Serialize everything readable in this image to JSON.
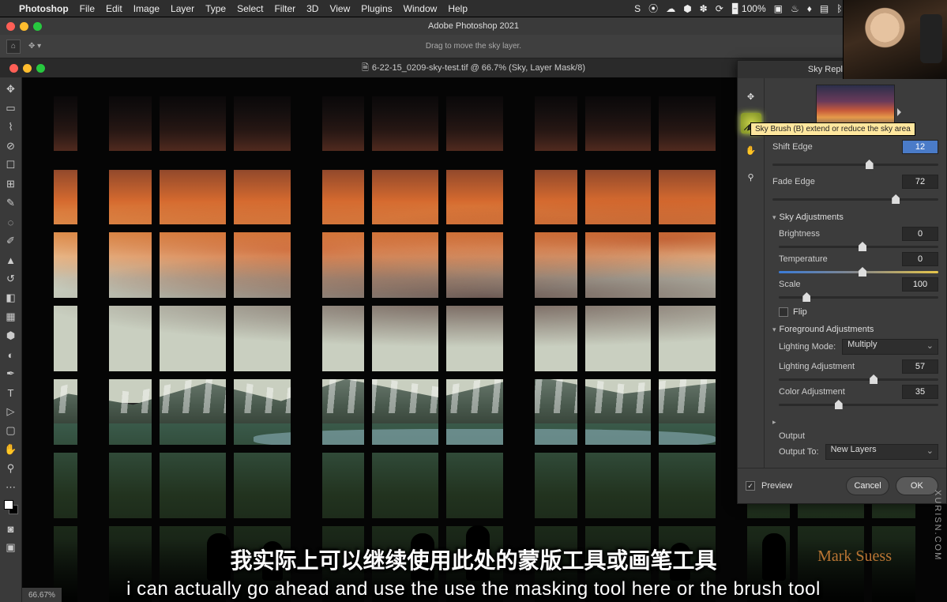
{
  "menubar": {
    "app": "Photoshop",
    "items": [
      "File",
      "Edit",
      "Image",
      "Layer",
      "Type",
      "Select",
      "Filter",
      "3D",
      "View",
      "Plugins",
      "Window",
      "Help"
    ],
    "right_status": "100%"
  },
  "window": {
    "title": "Adobe Photoshop 2021"
  },
  "options_bar": {
    "hint": "Drag to move the sky layer."
  },
  "document_tab": {
    "label": "6-22-15_0209-sky-test.tif @ 66.7% (Sky, Layer Mask/8)"
  },
  "status": {
    "zoom": "66.67%"
  },
  "panel": {
    "title": "Sky Replacement",
    "tooltip": "Sky Brush (B) extend or reduce the sky area",
    "shift_edge": {
      "label": "Shift Edge",
      "value": "12",
      "pos": 56
    },
    "fade_edge": {
      "label": "Fade Edge",
      "value": "72",
      "pos": 72
    },
    "section_sky": "Sky Adjustments",
    "brightness": {
      "label": "Brightness",
      "value": "0",
      "pos": 50
    },
    "temperature": {
      "label": "Temperature",
      "value": "0",
      "pos": 50
    },
    "scale": {
      "label": "Scale",
      "value": "100",
      "pos": 15
    },
    "flip_label": "Flip",
    "flip_checked": false,
    "section_fg": "Foreground Adjustments",
    "lighting_mode_label": "Lighting Mode:",
    "lighting_mode_value": "Multiply",
    "lighting_adj": {
      "label": "Lighting Adjustment",
      "value": "57",
      "pos": 57
    },
    "color_adj": {
      "label": "Color Adjustment",
      "value": "35",
      "pos": 35
    },
    "section_output": "Output",
    "output_to_label": "Output To:",
    "output_to_value": "New Layers",
    "preview_label": "Preview",
    "preview_checked": true,
    "cancel": "Cancel",
    "ok": "OK"
  },
  "subtitles": {
    "cn": "我实际上可以继续使用此处的蒙版工具或画笔工具",
    "en": "i can actually go ahead and use the use the masking tool here or the brush tool"
  },
  "watermark": "XURISN.COM",
  "signature": "Mark Suess"
}
